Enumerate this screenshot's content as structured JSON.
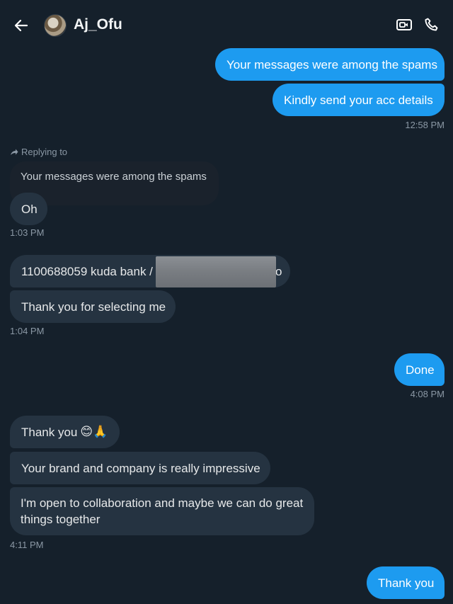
{
  "header": {
    "title": "Aj_Ofu",
    "back_icon": "back-arrow-icon",
    "video_icon": "video-call-icon",
    "phone_icon": "phone-call-icon"
  },
  "messages": [
    {
      "direction": "out",
      "text": "Your messages were among the spams"
    },
    {
      "direction": "out",
      "text": "Kindly send your acc details"
    },
    {
      "direction": "in",
      "text": "Oh"
    },
    {
      "direction": "in",
      "text": "1100688059 kuda bank /",
      "tail": "o"
    },
    {
      "direction": "in",
      "text": "Thank you for selecting me"
    },
    {
      "direction": "out",
      "text": "Done"
    },
    {
      "direction": "in",
      "text": "Thank you",
      "emoji": "😊🙏"
    },
    {
      "direction": "in",
      "text": "Your brand and company is really impressive"
    },
    {
      "direction": "in",
      "text": "I'm open to collaboration and maybe we can do great things together"
    },
    {
      "direction": "out",
      "text": "Thank you"
    }
  ],
  "reply": {
    "label": "Replying to",
    "quoted_text": "Your messages were among the spams"
  },
  "timestamps": [
    "12:58 PM",
    "1:03 PM",
    "1:04 PM",
    "4:08 PM",
    "4:11 PM"
  ],
  "colors": {
    "background": "#15202b",
    "outgoing_bubble": "#1d9bf0",
    "incoming_bubble": "#253341",
    "timestamp": "#8b98a5"
  }
}
